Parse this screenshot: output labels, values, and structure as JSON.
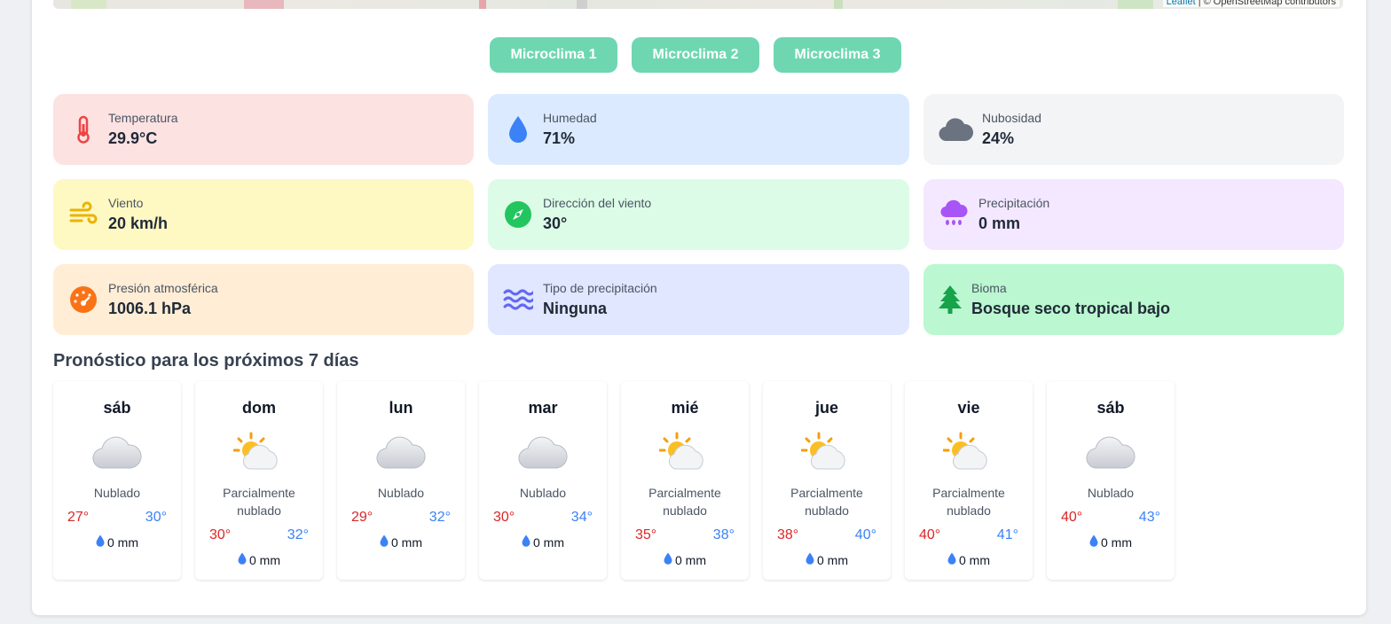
{
  "map": {
    "attribution_link": "Leaflet",
    "attribution_text": " | © OpenStreetMap contributors"
  },
  "microclimates": [
    "Microclima 1",
    "Microclima 2",
    "Microclima 3"
  ],
  "colors": {
    "button": "#6ed7b1",
    "min_temp": "#dc2626",
    "max_temp": "#3b82f6"
  },
  "stats": [
    {
      "label": "Temperatura",
      "value": "29.9°C",
      "icon": "thermometer-icon",
      "bg": "#fde2e2",
      "color": "#ef4444"
    },
    {
      "label": "Humedad",
      "value": "71%",
      "icon": "water-drop-icon",
      "bg": "#dbeafe",
      "color": "#3b82f6"
    },
    {
      "label": "Nubosidad",
      "value": "24%",
      "icon": "cloud-icon",
      "bg": "#f3f4f6",
      "color": "#6b7280"
    },
    {
      "label": "Viento",
      "value": "20 km/h",
      "icon": "wind-icon",
      "bg": "#fef8c3",
      "color": "#eab308"
    },
    {
      "label": "Dirección del viento",
      "value": "30°",
      "icon": "compass-icon",
      "bg": "#dcfce7",
      "color": "#22c55e"
    },
    {
      "label": "Precipitación",
      "value": "0 mm",
      "icon": "rain-cloud-icon",
      "bg": "#f3e8ff",
      "color": "#a855f7"
    },
    {
      "label": "Presión atmosférica",
      "value": "1006.1 hPa",
      "icon": "gauge-icon",
      "bg": "#ffedd5",
      "color": "#f97316"
    },
    {
      "label": "Tipo de precipitación",
      "value": "Ninguna",
      "icon": "waves-icon",
      "bg": "#e0e7ff",
      "color": "#6366f1"
    },
    {
      "label": "Bioma",
      "value": "Bosque seco tropical bajo",
      "icon": "tree-icon",
      "bg": "#bbf7d0",
      "color": "#16a34a"
    }
  ],
  "forecast": {
    "title": "Pronóstico para los próximos 7 días",
    "days": [
      {
        "day": "sáb",
        "condition": "Nublado",
        "icon": "cloud-icon",
        "min": "27°",
        "max": "30°",
        "rain": "0 mm"
      },
      {
        "day": "dom",
        "condition": "Parcialmente nublado",
        "icon": "partly-cloudy-icon",
        "min": "30°",
        "max": "32°",
        "rain": "0 mm"
      },
      {
        "day": "lun",
        "condition": "Nublado",
        "icon": "cloud-icon",
        "min": "29°",
        "max": "32°",
        "rain": "0 mm"
      },
      {
        "day": "mar",
        "condition": "Nublado",
        "icon": "cloud-icon",
        "min": "30°",
        "max": "34°",
        "rain": "0 mm"
      },
      {
        "day": "mié",
        "condition": "Parcialmente nublado",
        "icon": "partly-cloudy-icon",
        "min": "35°",
        "max": "38°",
        "rain": "0 mm"
      },
      {
        "day": "jue",
        "condition": "Parcialmente nublado",
        "icon": "partly-cloudy-icon",
        "min": "38°",
        "max": "40°",
        "rain": "0 mm"
      },
      {
        "day": "vie",
        "condition": "Parcialmente nublado",
        "icon": "partly-cloudy-icon",
        "min": "40°",
        "max": "41°",
        "rain": "0 mm"
      },
      {
        "day": "sáb",
        "condition": "Nublado",
        "icon": "cloud-icon",
        "min": "40°",
        "max": "43°",
        "rain": "0 mm"
      }
    ]
  }
}
